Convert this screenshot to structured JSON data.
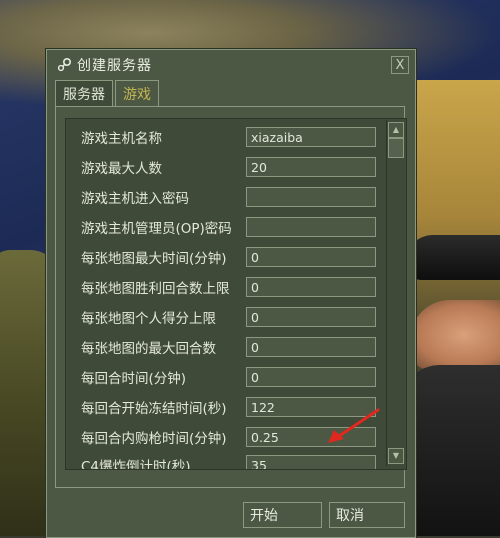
{
  "dialog": {
    "title": "创建服务器",
    "tabs": [
      {
        "label": "服务器",
        "active": false
      },
      {
        "label": "游戏",
        "active": true
      }
    ],
    "close_label": "X"
  },
  "settings": [
    {
      "label": "游戏主机名称",
      "value": "xiazaiba"
    },
    {
      "label": "游戏最大人数",
      "value": "20"
    },
    {
      "label": "游戏主机进入密码",
      "value": ""
    },
    {
      "label": "游戏主机管理员(OP)密码",
      "value": ""
    },
    {
      "label": "每张地图最大时间(分钟)",
      "value": "0"
    },
    {
      "label": "每张地图胜利回合数上限",
      "value": "0"
    },
    {
      "label": "每张地图个人得分上限",
      "value": "0"
    },
    {
      "label": "每张地图的最大回合数",
      "value": "0"
    },
    {
      "label": "每回合时间(分钟)",
      "value": "0"
    },
    {
      "label": "每回合开始冻结时间(秒)",
      "value": "122"
    },
    {
      "label": "每回合内购枪时间(分钟)",
      "value": "0.25"
    },
    {
      "label": "C4爆炸倒计时(秒)",
      "value": "35"
    }
  ],
  "buttons": {
    "start": "开始",
    "cancel": "取消"
  },
  "colors": {
    "dialog_bg": "#4c5844",
    "active_tab_text": "#c4b550",
    "annotation_arrow": "#e0281e"
  }
}
